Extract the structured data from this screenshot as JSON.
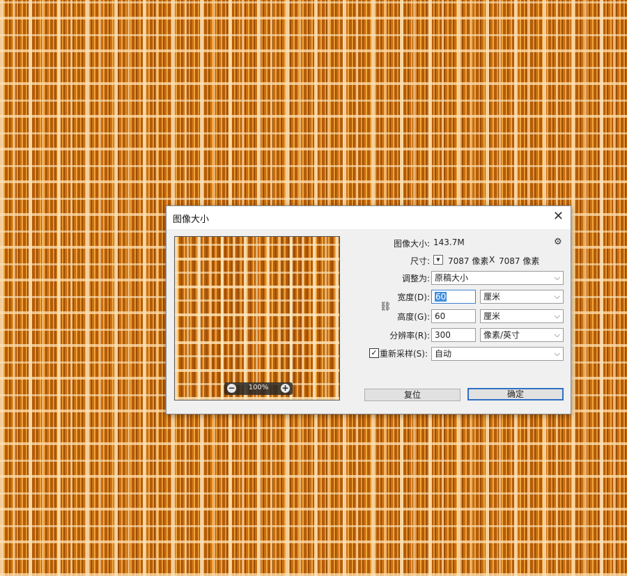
{
  "dialog": {
    "title": "图像大小",
    "close_symbol": "✕",
    "preview": {
      "zoom": "100%",
      "zoom_out_icon": "minus-circle-icon",
      "zoom_in_icon": "plus-circle-icon"
    },
    "image_size_label": "图像大小:",
    "image_size_value": "143.7M",
    "dimensions_label": "尺寸:",
    "dimensions_width": "7087 像素",
    "dimensions_x": "X",
    "dimensions_height": "7087 像素",
    "fit_to_label": "调整为:",
    "fit_to_value": "原稿大小",
    "width_label": "宽度(D):",
    "width_value": "60",
    "width_unit": "厘米",
    "height_label": "高度(G):",
    "height_value": "60",
    "height_unit": "厘米",
    "resolution_label": "分辨率(R):",
    "resolution_value": "300",
    "resolution_unit": "像素/英寸",
    "resample_label": "重新采样(S):",
    "resample_checked": true,
    "resample_value": "自动",
    "reset_button": "复位",
    "ok_button": "确定"
  }
}
